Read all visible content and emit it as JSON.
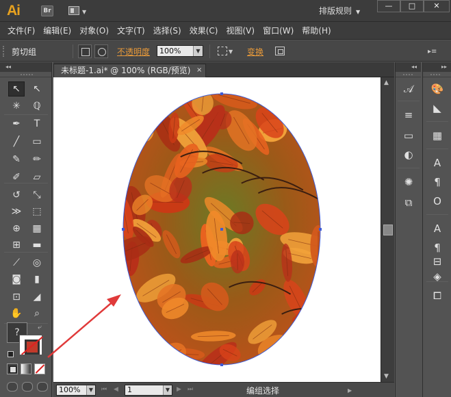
{
  "app": {
    "logo": "Ai",
    "bridge_label": "Br",
    "workspace": "排版规则",
    "window_buttons": [
      "—",
      "□",
      "✕"
    ]
  },
  "menu": [
    "文件(F)",
    "编辑(E)",
    "对象(O)",
    "文字(T)",
    "选择(S)",
    "效果(C)",
    "视图(V)",
    "窗口(W)",
    "帮助(H)"
  ],
  "control": {
    "selection_label": "剪切组",
    "opacity_label": "不透明度",
    "opacity_value": "100%",
    "transform_label": "变换"
  },
  "document": {
    "tab_title": "未标题-1.ai* @ 100% (RGB/预览)",
    "close_glyph": "×"
  },
  "status": {
    "zoom": "100%",
    "page": "1",
    "mode_text": "编组选择"
  },
  "tools": [
    {
      "name": "selection-tool-icon",
      "glyph": "↖"
    },
    {
      "name": "direct-selection-tool-icon",
      "glyph": "↖"
    },
    {
      "name": "magic-wand-tool-icon",
      "glyph": "✳"
    },
    {
      "name": "lasso-tool-icon",
      "glyph": "ℚ"
    },
    {
      "name": "pen-tool-icon",
      "glyph": "✒"
    },
    {
      "name": "type-tool-icon",
      "glyph": "T"
    },
    {
      "name": "line-tool-icon",
      "glyph": "╱"
    },
    {
      "name": "rectangle-tool-icon",
      "glyph": "▭"
    },
    {
      "name": "paintbrush-tool-icon",
      "glyph": "✎"
    },
    {
      "name": "pencil-tool-icon",
      "glyph": "✏"
    },
    {
      "name": "blob-brush-tool-icon",
      "glyph": "✐"
    },
    {
      "name": "eraser-tool-icon",
      "glyph": "▱"
    },
    {
      "name": "rotate-tool-icon",
      "glyph": "↺"
    },
    {
      "name": "scale-tool-icon",
      "glyph": "⤡"
    },
    {
      "name": "width-tool-icon",
      "glyph": "≫"
    },
    {
      "name": "free-transform-tool-icon",
      "glyph": "⬚"
    },
    {
      "name": "shape-builder-tool-icon",
      "glyph": "⊕"
    },
    {
      "name": "perspective-grid-tool-icon",
      "glyph": "▦"
    },
    {
      "name": "mesh-tool-icon",
      "glyph": "⊞"
    },
    {
      "name": "gradient-tool-icon",
      "glyph": "▬"
    },
    {
      "name": "eyedropper-tool-icon",
      "glyph": "⟋"
    },
    {
      "name": "blend-tool-icon",
      "glyph": "◎"
    },
    {
      "name": "symbol-sprayer-tool-icon",
      "glyph": "◙"
    },
    {
      "name": "column-graph-tool-icon",
      "glyph": "▮"
    },
    {
      "name": "artboard-tool-icon",
      "glyph": "⊡"
    },
    {
      "name": "slice-tool-icon",
      "glyph": "◢"
    },
    {
      "name": "hand-tool-icon",
      "glyph": "✋"
    },
    {
      "name": "zoom-tool-icon",
      "glyph": "⌕"
    }
  ],
  "fill_glyph": "?",
  "right_panel_1": [
    {
      "name": "character-style-icon",
      "glyph": "𝒜"
    },
    {
      "name": "stroke-panel-icon",
      "glyph": "≡"
    },
    {
      "name": "gradient-panel-icon",
      "glyph": "▭"
    },
    {
      "name": "transparency-panel-icon",
      "glyph": "◐"
    },
    {
      "name": "appearance-panel-icon",
      "glyph": "✺"
    },
    {
      "name": "graphic-styles-panel-icon",
      "glyph": "⧉"
    }
  ],
  "right_panel_2": [
    {
      "name": "color-panel-icon",
      "glyph": "🎨"
    },
    {
      "name": "color-guide-panel-icon",
      "glyph": "◣"
    },
    {
      "name": "swatches-panel-icon",
      "glyph": "▦"
    },
    {
      "name": "character-panel-icon",
      "glyph": "A"
    },
    {
      "name": "paragraph-panel-icon",
      "glyph": "¶"
    },
    {
      "name": "opentype-panel-icon",
      "glyph": "O"
    },
    {
      "name": "character-styles-panel-icon",
      "glyph": "A"
    },
    {
      "name": "paragraph-styles-panel-icon",
      "glyph": "¶"
    },
    {
      "name": "align-panel-icon",
      "glyph": "⊟"
    },
    {
      "name": "layers-panel-icon",
      "glyph": "◈"
    },
    {
      "name": "artboards-panel-icon",
      "glyph": "⧠"
    }
  ],
  "colors": {
    "accent_orange": "#e89a3a",
    "logo_orange": "#e8a21f",
    "arrow_red": "#e03a3a",
    "ui_dark": "#3c3c3c",
    "ui_panel": "#535353"
  }
}
